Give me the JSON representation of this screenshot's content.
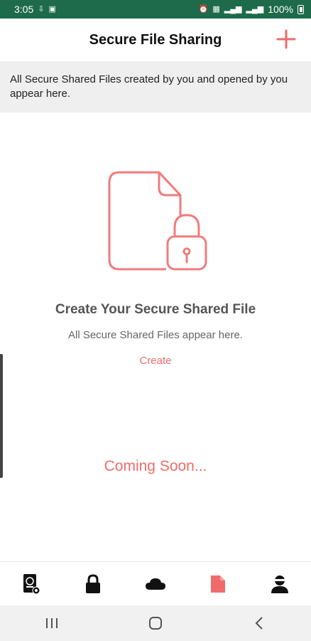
{
  "status_bar": {
    "time": "3:05",
    "battery": "100%"
  },
  "header": {
    "title": "Secure File Sharing"
  },
  "banner": {
    "text": "All Secure Shared Files created by you and opened by you appear here."
  },
  "empty_state": {
    "icon": "file-lock-icon",
    "title": "Create Your Secure Shared File",
    "subtitle": "All Secure Shared Files appear here.",
    "create_label": "Create",
    "coming_soon": "Coming Soon..."
  },
  "bottom_nav": {
    "items": [
      {
        "icon": "password-file-icon",
        "active": false
      },
      {
        "icon": "lock-icon",
        "active": false
      },
      {
        "icon": "cloud-icon",
        "active": false
      },
      {
        "icon": "shared-file-icon",
        "active": true
      },
      {
        "icon": "user-profile-icon",
        "active": false
      }
    ]
  },
  "colors": {
    "status_bar": "#1d6b4b",
    "accent": "#ef6b6b",
    "banner_bg": "#efefef"
  }
}
